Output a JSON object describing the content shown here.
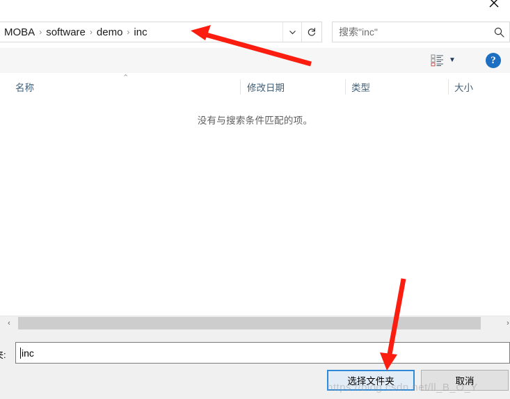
{
  "window": {
    "close_label": "close-icon",
    "type": "folder-picker-dialog"
  },
  "address_bar": {
    "breadcrumbs": [
      "MOBA",
      "software",
      "demo",
      "inc"
    ],
    "separator": "›",
    "dropdown_icon": "chevron-down-icon",
    "refresh_icon": "refresh-icon"
  },
  "search": {
    "placeholder": "搜索\"inc\"",
    "icon": "search-icon"
  },
  "toolbar": {
    "view_options_icon": "list-view-icon",
    "view_options_caret": "▼",
    "help_label": "?"
  },
  "columns": {
    "sort_caret": "⌃",
    "headers": [
      {
        "label": "名称"
      },
      {
        "label": "修改日期"
      },
      {
        "label": "类型"
      },
      {
        "label": "大小"
      }
    ]
  },
  "file_list": {
    "empty_message": "没有与搜索条件匹配的项。",
    "rows": []
  },
  "scrollbar": {
    "left_arrow": "‹",
    "right_arrow": "›"
  },
  "footer": {
    "folder_label": "夹:",
    "folder_value": "inc",
    "select_button": "选择文件夹",
    "cancel_button": "取消"
  },
  "watermark": {
    "text": "https://blog.csdn.net/ll_B_O_Y"
  },
  "colors": {
    "accent": "#2e8ad7",
    "help_blue": "#1c6fc1",
    "column_header_text": "#40607a",
    "annotation_arrow": "#fb1d10",
    "toolbar_bg": "#f6f6f6",
    "footer_bg": "#f0f0f0"
  }
}
